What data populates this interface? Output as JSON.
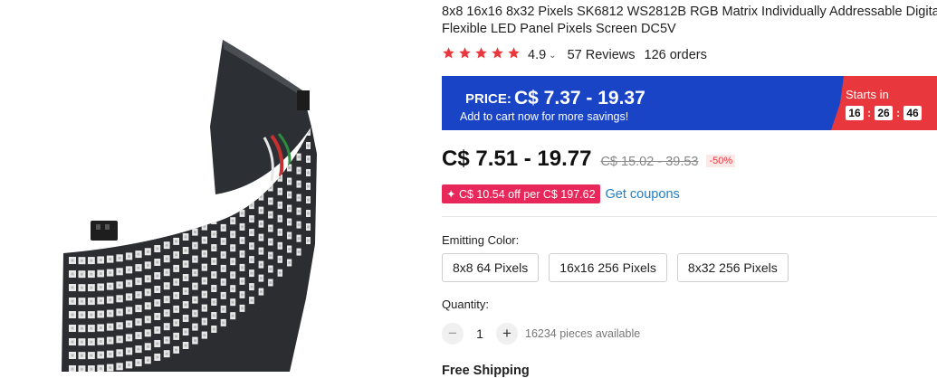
{
  "product": {
    "title_line_1": "8x8 16x16 8x32 Pixels SK6812 WS2812B RGB Matrix Individually Addressable Digital",
    "title_line_2": "Flexible LED Panel Pixels Screen DC5V",
    "image_icon": "flexible-led-matrix-panel-photo"
  },
  "rating": {
    "stars": 5,
    "value": "4.9",
    "reviews": "57 Reviews",
    "orders": "126 orders",
    "star_color": "#e8383d"
  },
  "promo": {
    "label": "PRICE:",
    "range": "C$ 7.37 - 19.37",
    "note": "Add to cart now for more savings!",
    "starts_in": "Starts in",
    "timer": [
      "16",
      "26",
      "46"
    ],
    "banner_color": "#1a44c6",
    "countdown_color": "#e8383d"
  },
  "price": {
    "current": "C$ 7.51 - 19.77",
    "original": "C$ 15.02 - 39.53",
    "discount": "-50%"
  },
  "coupon": {
    "text": "✦ C$ 10.54 off per C$ 197.62",
    "link": "Get coupons"
  },
  "options": {
    "label": "Emitting Color:",
    "values": [
      "8x8 64 Pixels",
      "16x16 256 Pixels",
      "8x32 256 Pixels"
    ]
  },
  "quantity": {
    "label": "Quantity:",
    "value": "1",
    "available": "16234 pieces available"
  },
  "shipping": {
    "heading": "Free Shipping"
  }
}
